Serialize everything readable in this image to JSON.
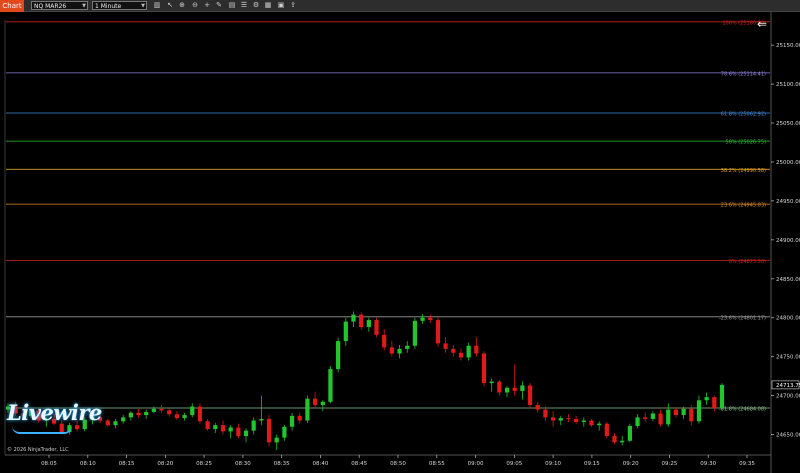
{
  "toolbar": {
    "app_tab": "Chart",
    "instrument": "NQ MAR26",
    "interval": "1 Minute",
    "icons": [
      "bars-type-icon",
      "pointer-icon",
      "zoom-in-icon",
      "zoom-out-icon",
      "crosshair-icon",
      "drawing-tools-icon",
      "data-box-icon",
      "properties-icon",
      "strategies-icon",
      "order-panel-icon",
      "template-icon",
      "share-icon"
    ]
  },
  "copyright": "© 2026 NinjaTrader, LLC",
  "logo": "Livewire",
  "colors": {
    "background": "#000000",
    "up_candle": "#22c52b",
    "down_candle": "#e01a1a",
    "accent": "#e04a1c"
  },
  "chart_data": {
    "type": "candlestick",
    "instrument": "NQ MAR26",
    "interval": "1 Minute",
    "ylim": [
      24625,
      25190
    ],
    "yticks": [
      25150,
      25100,
      25050,
      25000,
      24950,
      24900,
      24850,
      24800,
      24750,
      24700,
      24650
    ],
    "ytick_labels": [
      "25150.00",
      "25100.00",
      "25050.00",
      "25000.00",
      "24950.00",
      "24900.00",
      "24850.00",
      "24800.00",
      "24750.00",
      "24700.00",
      "24650.00"
    ],
    "xtick_labels": [
      "08:05",
      "08:10",
      "08:15",
      "08:20",
      "08:25",
      "08:30",
      "08:35",
      "08:40",
      "08:45",
      "08:50",
      "08:55",
      "09:00",
      "09:05",
      "09:10",
      "09:15",
      "09:20",
      "09:25",
      "09:30",
      "09:35"
    ],
    "last_price_label": "24713.75",
    "last_price": 24713.75,
    "fib_levels": [
      {
        "label": "100% (25180.00)",
        "value": 25180.0,
        "color": "#d42020"
      },
      {
        "label": "78.6% (25114.41)",
        "value": 25114.41,
        "color": "#8f80e0"
      },
      {
        "label": "61.8% (25062.92)",
        "value": 25062.92,
        "color": "#3d8fe0"
      },
      {
        "label": "50% (25026.75)",
        "value": 25026.75,
        "color": "#2ec42e"
      },
      {
        "label": "38.2% (24990.58)",
        "value": 24990.58,
        "color": "#e0a020"
      },
      {
        "label": "23.6% (24945.83)",
        "value": 24945.83,
        "color": "#e08a20"
      },
      {
        "label": "0% (24873.50)",
        "value": 24873.5,
        "color": "#d42020"
      },
      {
        "label": "-23.6% (24801.17)",
        "value": 24801.17,
        "color": "#999999"
      },
      {
        "label": "-61.8% (24684.08)",
        "value": 24684.08,
        "color": "#8fc08f"
      }
    ],
    "candles": [
      [
        24682,
        24690,
        24678,
        24686
      ],
      [
        24686,
        24692,
        24674,
        24677
      ],
      [
        24677,
        24681,
        24670,
        24674
      ],
      [
        24674,
        24684,
        24672,
        24681
      ],
      [
        24681,
        24683,
        24665,
        24668
      ],
      [
        24668,
        24672,
        24660,
        24670
      ],
      [
        24670,
        24676,
        24662,
        24664
      ],
      [
        24664,
        24668,
        24650,
        24653
      ],
      [
        24653,
        24665,
        24650,
        24662
      ],
      [
        24662,
        24668,
        24654,
        24657
      ],
      [
        24657,
        24672,
        24654,
        24669
      ],
      [
        24669,
        24674,
        24663,
        24672
      ],
      [
        24672,
        24676,
        24665,
        24668
      ],
      [
        24668,
        24670,
        24660,
        24662
      ],
      [
        24662,
        24670,
        24658,
        24667
      ],
      [
        24667,
        24675,
        24664,
        24672
      ],
      [
        24672,
        24680,
        24668,
        24678
      ],
      [
        24678,
        24683,
        24672,
        24675
      ],
      [
        24675,
        24682,
        24670,
        24679
      ],
      [
        24679,
        24686,
        24677,
        24683
      ],
      [
        24683,
        24688,
        24678,
        24681
      ],
      [
        24681,
        24684,
        24673,
        24676
      ],
      [
        24676,
        24680,
        24669,
        24671
      ],
      [
        24671,
        24678,
        24668,
        24675
      ],
      [
        24675,
        24690,
        24672,
        24686
      ],
      [
        24686,
        24690,
        24664,
        24667
      ],
      [
        24667,
        24670,
        24655,
        24657
      ],
      [
        24657,
        24665,
        24652,
        24662
      ],
      [
        24662,
        24668,
        24650,
        24654
      ],
      [
        24654,
        24662,
        24645,
        24659
      ],
      [
        24659,
        24664,
        24645,
        24648
      ],
      [
        24648,
        24658,
        24640,
        24655
      ],
      [
        24655,
        24672,
        24650,
        24668
      ],
      [
        24668,
        24700,
        24662,
        24670
      ],
      [
        24670,
        24675,
        24635,
        24640
      ],
      [
        24640,
        24650,
        24630,
        24646
      ],
      [
        24646,
        24662,
        24642,
        24660
      ],
      [
        24660,
        24678,
        24655,
        24674
      ],
      [
        24674,
        24678,
        24664,
        24668
      ],
      [
        24668,
        24700,
        24665,
        24696
      ],
      [
        24696,
        24705,
        24684,
        24688
      ],
      [
        24688,
        24694,
        24680,
        24692
      ],
      [
        24692,
        24738,
        24690,
        24734
      ],
      [
        24734,
        24774,
        24730,
        24770
      ],
      [
        24770,
        24800,
        24764,
        24795
      ],
      [
        24795,
        24808,
        24788,
        24804
      ],
      [
        24804,
        24807,
        24785,
        24788
      ],
      [
        24788,
        24800,
        24782,
        24797
      ],
      [
        24797,
        24800,
        24775,
        24778
      ],
      [
        24778,
        24785,
        24758,
        24762
      ],
      [
        24762,
        24770,
        24750,
        24754
      ],
      [
        24754,
        24765,
        24748,
        24760
      ],
      [
        24760,
        24770,
        24755,
        24764
      ],
      [
        24764,
        24800,
        24760,
        24796
      ],
      [
        24796,
        24805,
        24792,
        24800
      ],
      [
        24800,
        24804,
        24793,
        24797
      ],
      [
        24797,
        24800,
        24763,
        24767
      ],
      [
        24767,
        24775,
        24755,
        24760
      ],
      [
        24760,
        24765,
        24750,
        24755
      ],
      [
        24755,
        24760,
        24745,
        24749
      ],
      [
        24749,
        24768,
        24745,
        24764
      ],
      [
        24764,
        24775,
        24750,
        24754
      ],
      [
        24754,
        24757,
        24712,
        24716
      ],
      [
        24716,
        24722,
        24705,
        24718
      ],
      [
        24718,
        24720,
        24700,
        24704
      ],
      [
        24704,
        24712,
        24698,
        24710
      ],
      [
        24710,
        24740,
        24700,
        24706
      ],
      [
        24706,
        24718,
        24695,
        24713
      ],
      [
        24713,
        24716,
        24685,
        24688
      ],
      [
        24688,
        24692,
        24678,
        24682
      ],
      [
        24682,
        24686,
        24668,
        24672
      ],
      [
        24672,
        24680,
        24660,
        24668
      ],
      [
        24668,
        24674,
        24662,
        24671
      ],
      [
        24671,
        24676,
        24666,
        24670
      ],
      [
        24670,
        24674,
        24664,
        24666
      ],
      [
        24666,
        24672,
        24660,
        24668
      ],
      [
        24668,
        24670,
        24660,
        24662
      ],
      [
        24662,
        24667,
        24655,
        24664
      ],
      [
        24664,
        24666,
        24645,
        24648
      ],
      [
        24648,
        24652,
        24638,
        24640
      ],
      [
        24640,
        24648,
        24636,
        24642
      ],
      [
        24642,
        24664,
        24640,
        24661
      ],
      [
        24661,
        24676,
        24658,
        24672
      ],
      [
        24672,
        24678,
        24666,
        24670
      ],
      [
        24670,
        24680,
        24667,
        24677
      ],
      [
        24677,
        24682,
        24660,
        24663
      ],
      [
        24663,
        24690,
        24660,
        24682
      ],
      [
        24682,
        24685,
        24672,
        24675
      ],
      [
        24675,
        24686,
        24670,
        24683
      ],
      [
        24683,
        24688,
        24662,
        24667
      ],
      [
        24667,
        24700,
        24664,
        24694
      ],
      [
        24694,
        24704,
        24688,
        24698
      ],
      [
        24698,
        24700,
        24680,
        24684
      ],
      [
        24684,
        24716,
        24682,
        24713.75
      ]
    ]
  }
}
